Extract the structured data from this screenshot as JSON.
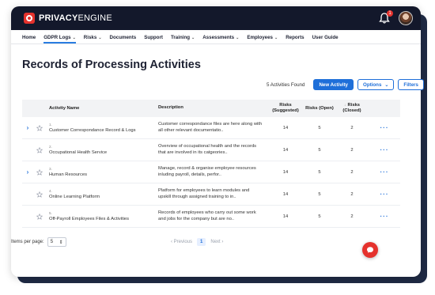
{
  "brand": {
    "name_bold": "PRIVACY",
    "name_rest": "ENGINE"
  },
  "notifications": {
    "count": "1"
  },
  "nav": [
    {
      "label": "Home",
      "dropdown": false
    },
    {
      "label": "GDPR Logs",
      "dropdown": true,
      "active": true
    },
    {
      "label": "Risks",
      "dropdown": true
    },
    {
      "label": "Documents",
      "dropdown": false
    },
    {
      "label": "Support",
      "dropdown": false
    },
    {
      "label": "Training",
      "dropdown": true
    },
    {
      "label": "Assessments",
      "dropdown": true
    },
    {
      "label": "Employees",
      "dropdown": true
    },
    {
      "label": "Reports",
      "dropdown": false
    },
    {
      "label": "User Guide",
      "dropdown": false
    }
  ],
  "page": {
    "title": "Records of Processing Activities"
  },
  "toolbar": {
    "found": "5 Activities Found",
    "new_label": "New Activity",
    "options_label": "Options",
    "filters_label": "Filters"
  },
  "table": {
    "headers": {
      "name": "Activity Name",
      "description": "Description",
      "risks_suggested": "Risks (Suggested)",
      "risks_open": "Risks (Open)",
      "risks_closed": "Risks (Closed)"
    },
    "rows": [
      {
        "expandable": true,
        "num": "1.",
        "name": "Customer Correspondance Record & Logs",
        "description": "Customer correspondance files are here along with all other relevant documentatio..",
        "suggested": "14",
        "open": "5",
        "closed": "2"
      },
      {
        "expandable": false,
        "num": "2.",
        "name": "Occupational Health Service",
        "description": "Overview of occupational health and the records that are involved in its catgeories..",
        "suggested": "14",
        "open": "5",
        "closed": "2"
      },
      {
        "expandable": true,
        "num": "3.",
        "name": "Human Resources",
        "description": "Manage, record & organise employee resources inluding payroll, details, perfor..",
        "suggested": "14",
        "open": "5",
        "closed": "2"
      },
      {
        "expandable": false,
        "num": "4.",
        "name": "Online Learning Platform",
        "description": "Platform for employees to learn modules and upskill through assigned training to in..",
        "suggested": "14",
        "open": "5",
        "closed": "2"
      },
      {
        "expandable": false,
        "num": "5.",
        "name": "Off-Payroll Employees Files & Activities",
        "description": "Records of employees who carry out some work and jobs for the company but are no..",
        "suggested": "14",
        "open": "5",
        "closed": "2"
      }
    ]
  },
  "footer": {
    "per_page_label": "Items per page:",
    "per_page_value": "5",
    "prev_label": "Previous",
    "current_page": "1",
    "next_label": "Next"
  },
  "colors": {
    "accent": "#1e6fd9",
    "brand_red": "#e5322d",
    "topbar": "#13182b"
  }
}
